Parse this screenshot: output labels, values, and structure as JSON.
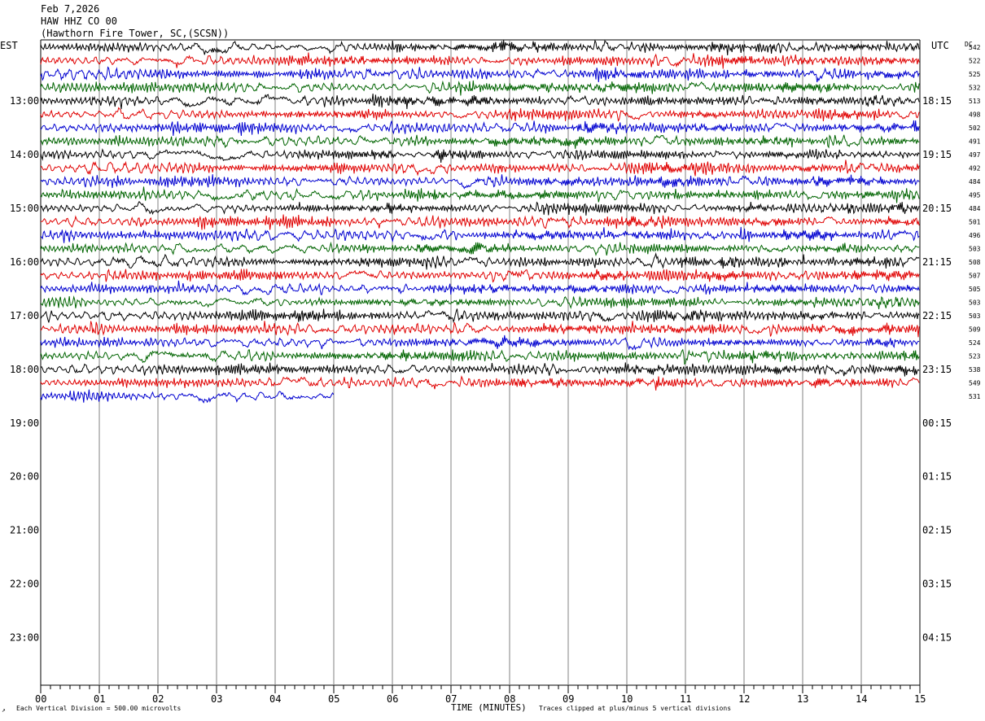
{
  "header": {
    "date": "Feb 7,2026",
    "station": "HAW HHZ CO 00",
    "location": "(Hawthorn Fire Tower, SC,(SCSN))"
  },
  "left_zone": "EST",
  "right_zone": "UTC",
  "dc_header": "DC",
  "footer": {
    "scale": "Each Vertical Division =  500.00 microvolts",
    "xlabel": "TIME (MINUTES)",
    "clip": "Traces clipped at plus/minus 5 vertical divisions",
    "corner_mark": "↗"
  },
  "colors": {
    "cycle": [
      "#000000",
      "#e00000",
      "#0000d0",
      "#006400"
    ],
    "grid": "#808080"
  },
  "chart_data": {
    "type": "line",
    "x_ticks": [
      "00",
      "01",
      "02",
      "03",
      "04",
      "05",
      "06",
      "07",
      "08",
      "09",
      "10",
      "11",
      "12",
      "13",
      "14",
      "15"
    ],
    "xlim": [
      0,
      15
    ],
    "left_hour_labels": [
      "13:00",
      "14:00",
      "15:00",
      "16:00",
      "17:00",
      "18:00",
      "19:00",
      "20:00",
      "21:00",
      "22:00",
      "23:00"
    ],
    "right_hour_labels": [
      "18:15",
      "19:15",
      "20:15",
      "21:15",
      "22:15",
      "23:15",
      "00:15",
      "01:15",
      "02:15",
      "03:15",
      "04:15"
    ],
    "row_dc_values": [
      542,
      522,
      525,
      532,
      513,
      498,
      502,
      491,
      497,
      492,
      484,
      495,
      484,
      501,
      496,
      503,
      508,
      507,
      505,
      503,
      503,
      509,
      524,
      523,
      538,
      549,
      531
    ],
    "rows_total": 48,
    "rows_recorded": 27,
    "last_row_end_minute": 5.0
  }
}
